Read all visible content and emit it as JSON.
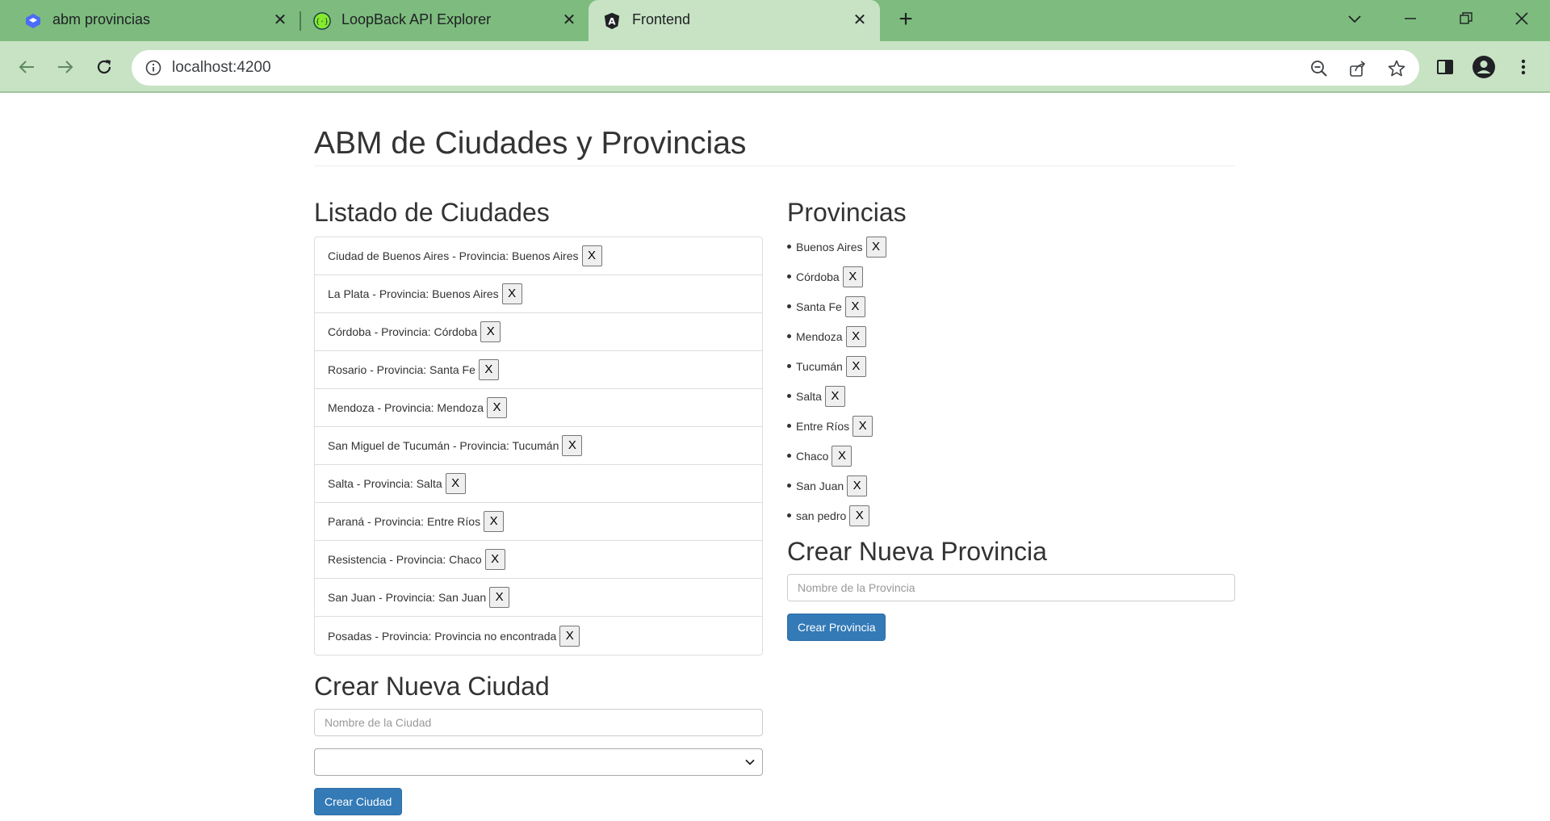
{
  "browser": {
    "tabs": [
      {
        "title": "abm provincias",
        "icon": "stack-icon"
      },
      {
        "title": "LoopBack API Explorer",
        "icon": "api-icon"
      },
      {
        "title": "Frontend",
        "icon": "angular-icon"
      }
    ],
    "url": "localhost:4200"
  },
  "page": {
    "title": "ABM de Ciudades y Provincias",
    "cities": {
      "heading": "Listado de Ciudades",
      "items": [
        "Ciudad de Buenos Aires - Provincia: Buenos Aires",
        "La Plata - Provincia: Buenos Aires",
        "Córdoba - Provincia: Córdoba",
        "Rosario - Provincia: Santa Fe",
        "Mendoza - Provincia: Mendoza",
        "San Miguel de Tucumán - Provincia: Tucumán",
        "Salta - Provincia: Salta",
        "Paraná - Provincia: Entre Ríos",
        "Resistencia - Provincia: Chaco",
        "San Juan - Provincia: San Juan",
        "Posadas - Provincia: Provincia no encontrada"
      ],
      "delete_label": "X"
    },
    "create_city": {
      "heading": "Crear Nueva Ciudad",
      "name_placeholder": "Nombre de la Ciudad",
      "province_select_value": "",
      "submit_label": "Crear Ciudad"
    },
    "provinces": {
      "heading": "Provincias",
      "items": [
        "Buenos Aires",
        "Córdoba",
        "Santa Fe",
        "Mendoza",
        "Tucumán",
        "Salta",
        "Entre Ríos",
        "Chaco",
        "San Juan",
        "san pedro"
      ],
      "delete_label": "X"
    },
    "create_province": {
      "heading": "Crear Nueva Provincia",
      "name_placeholder": "Nombre de la Provincia",
      "submit_label": "Crear Provincia"
    }
  },
  "colors": {
    "chrome_frame": "#7dbc7e",
    "chrome_toolbar": "#c7e3c4",
    "primary_button": "#337ab7"
  }
}
